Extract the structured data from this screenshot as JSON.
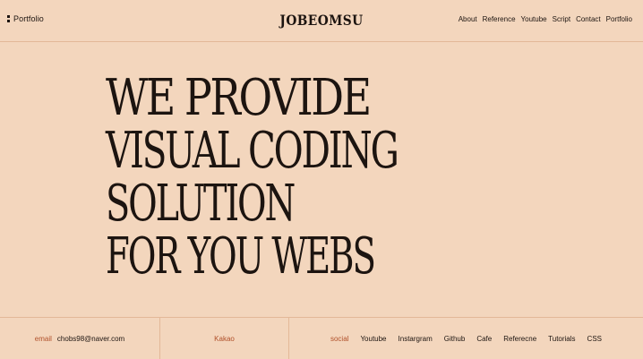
{
  "header": {
    "left_link": "Portfolio",
    "logo": "JOBEOMSU",
    "nav": [
      "About",
      "Reference",
      "Youtube",
      "Script",
      "Contact",
      "Portfolio"
    ]
  },
  "hero": {
    "lines": [
      "WE PROVIDE",
      "VISUAL CODING",
      "SOLUTION",
      "FOR YOU WEBS"
    ]
  },
  "footer": {
    "email_label": "email",
    "email_value": "chobs98@naver.com",
    "kakao": "Kakao",
    "social_label": "social",
    "social_links": [
      "Youtube",
      "Instargram",
      "Github",
      "Cafe",
      "Referecne",
      "Tutorials",
      "CSS"
    ]
  },
  "colors": {
    "background": "#f3d6bd",
    "text": "#1c1410",
    "accent": "#b0502a",
    "divider": "#e3b898"
  }
}
